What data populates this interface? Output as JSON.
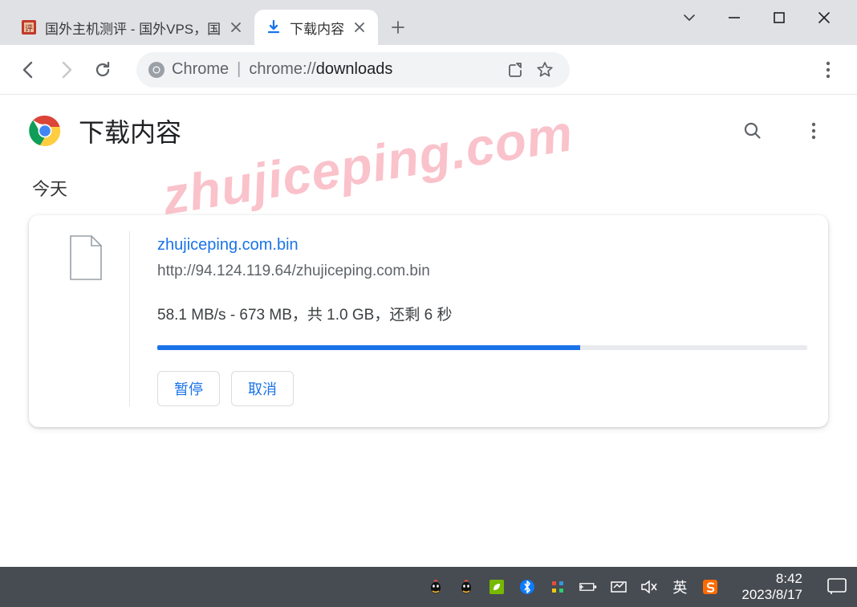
{
  "tabs": [
    {
      "title": "国外主机测评 - 国外VPS，国"
    },
    {
      "title": "下载内容"
    }
  ],
  "omnibox": {
    "chip_label": "Chrome",
    "url_prefix": "chrome://",
    "url_bold": "downloads"
  },
  "page": {
    "title": "下载内容",
    "section_label": "今天",
    "download": {
      "filename": "zhujiceping.com.bin",
      "url": "http://94.124.119.64/zhujiceping.com.bin",
      "status": "58.1 MB/s - 673 MB，共 1.0 GB，还剩 6 秒",
      "progress_percent": 65,
      "pause_label": "暂停",
      "cancel_label": "取消"
    }
  },
  "watermark": "zhujiceping.com",
  "taskbar": {
    "ime": "英",
    "time": "8:42",
    "date": "2023/8/17"
  }
}
